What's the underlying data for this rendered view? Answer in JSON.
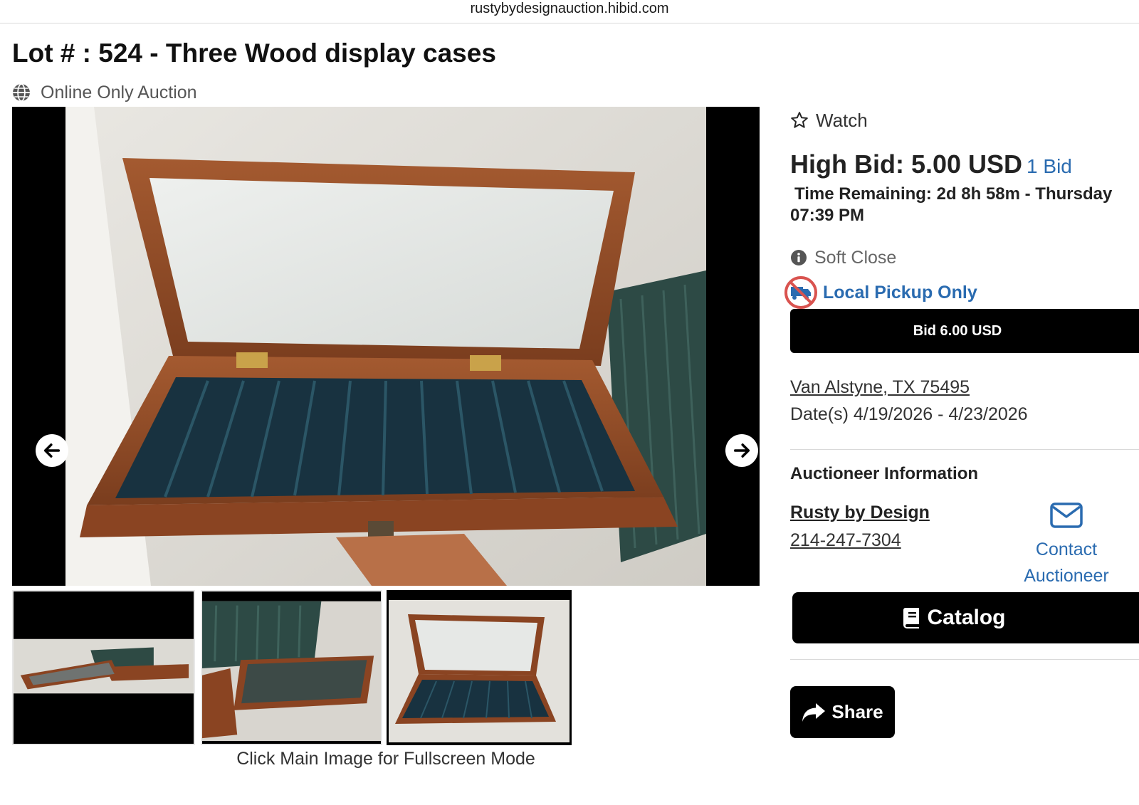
{
  "browser": {
    "url": "rustybydesignauction.hibid.com"
  },
  "lot": {
    "title": "Lot # : 524 - Three Wood display cases",
    "auction_type": "Online Only Auction"
  },
  "gallery": {
    "hint": "Click Main Image for Fullscreen Mode",
    "thumbnail_count": 3
  },
  "bidding": {
    "watch_label": "Watch",
    "high_bid_label": "High Bid: 5.00 USD",
    "bid_count": "1 Bid",
    "time_remaining_line1": "Time Remaining: 2d 8h 58m - Thursday",
    "time_remaining_line2": "07:39 PM",
    "soft_close": "Soft Close",
    "pickup": "Local Pickup Only",
    "bid_button": "Bid 6.00 USD"
  },
  "location": {
    "address": "Van Alstyne, TX 75495",
    "dates": "Date(s) 4/19/2026 - 4/23/2026"
  },
  "auctioneer": {
    "heading": "Auctioneer Information",
    "name": "Rusty by Design",
    "phone": "214-247-7304",
    "contact_line1": "Contact",
    "contact_line2": "Auctioneer"
  },
  "actions": {
    "catalog": "Catalog",
    "share": "Share"
  },
  "colors": {
    "link_blue": "#2a6bb0",
    "button_black": "#000000",
    "pickup_ring": "#d9534f"
  },
  "icons": {
    "auction_type": "globe-icon",
    "watch": "star-outline-icon",
    "soft_close": "info-circle-icon",
    "pickup": "no-shipping-truck-icon",
    "contact": "envelope-icon",
    "catalog": "book-icon",
    "share": "share-arrow-icon",
    "prev": "arrow-left-icon",
    "next": "arrow-right-icon"
  }
}
